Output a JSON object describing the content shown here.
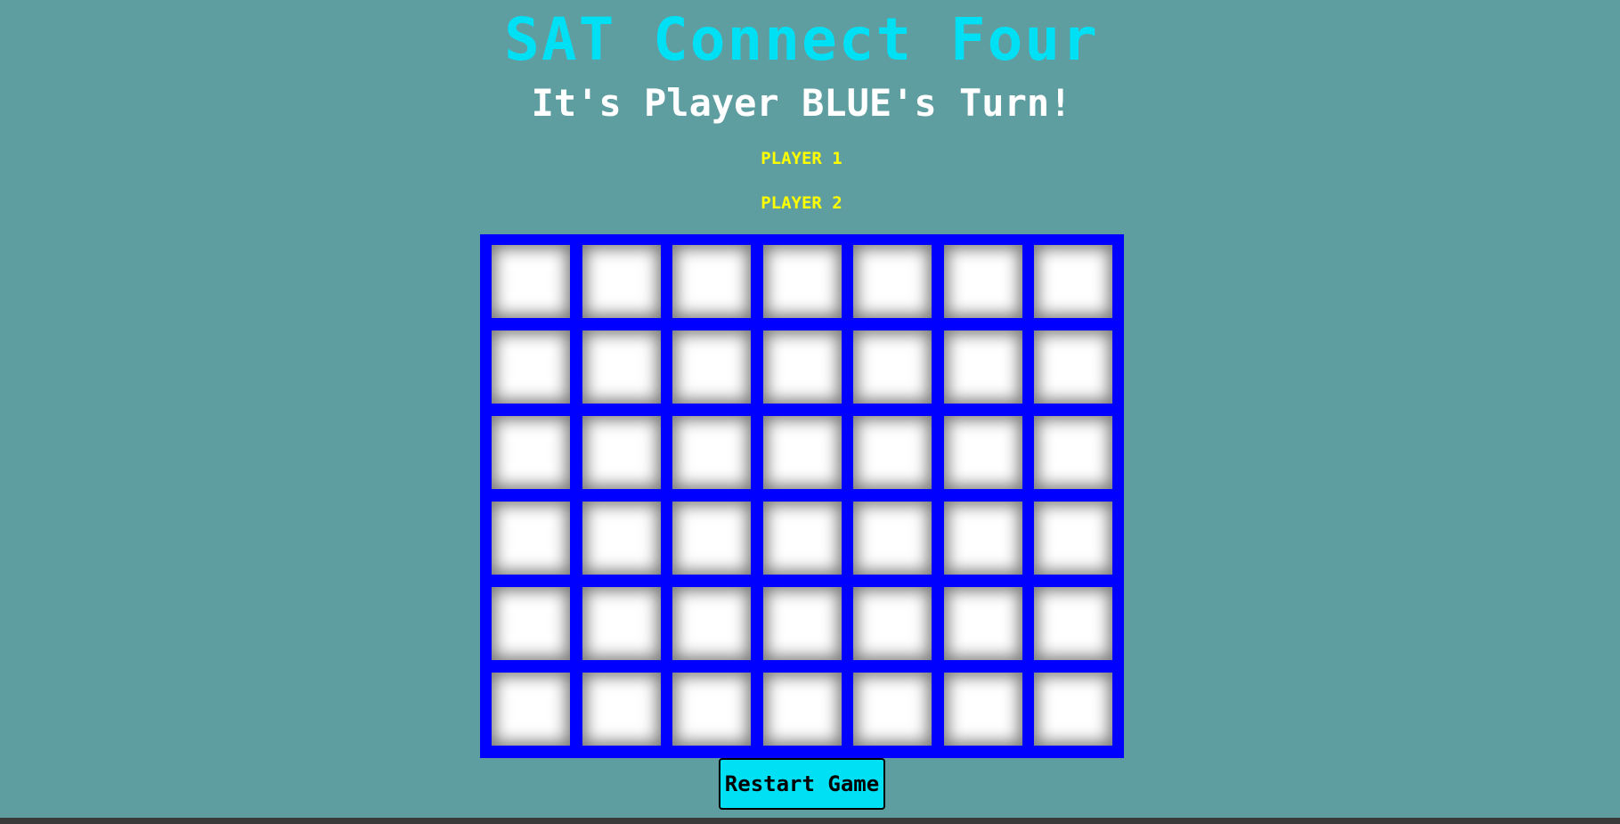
{
  "title": "SAT Connect Four",
  "turn_message": "It's Player BLUE's Turn!",
  "players": {
    "player1": "PLAYER 1",
    "player2": "PLAYER 2"
  },
  "board": {
    "rows": 6,
    "columns": 7,
    "frame_color": "#0000ff",
    "cells": [
      [
        "empty",
        "empty",
        "empty",
        "empty",
        "empty",
        "empty",
        "empty"
      ],
      [
        "empty",
        "empty",
        "empty",
        "empty",
        "empty",
        "empty",
        "empty"
      ],
      [
        "empty",
        "empty",
        "empty",
        "empty",
        "empty",
        "empty",
        "empty"
      ],
      [
        "empty",
        "empty",
        "empty",
        "empty",
        "empty",
        "empty",
        "empty"
      ],
      [
        "empty",
        "empty",
        "empty",
        "empty",
        "empty",
        "empty",
        "empty"
      ],
      [
        "empty",
        "empty",
        "empty",
        "empty",
        "empty",
        "empty",
        "empty"
      ]
    ]
  },
  "restart_button": "Restart Game",
  "colors": {
    "background": "#5f9ea0",
    "title": "#00e0f5",
    "player_labels": "#ffff00",
    "button": "#00e0f5"
  }
}
